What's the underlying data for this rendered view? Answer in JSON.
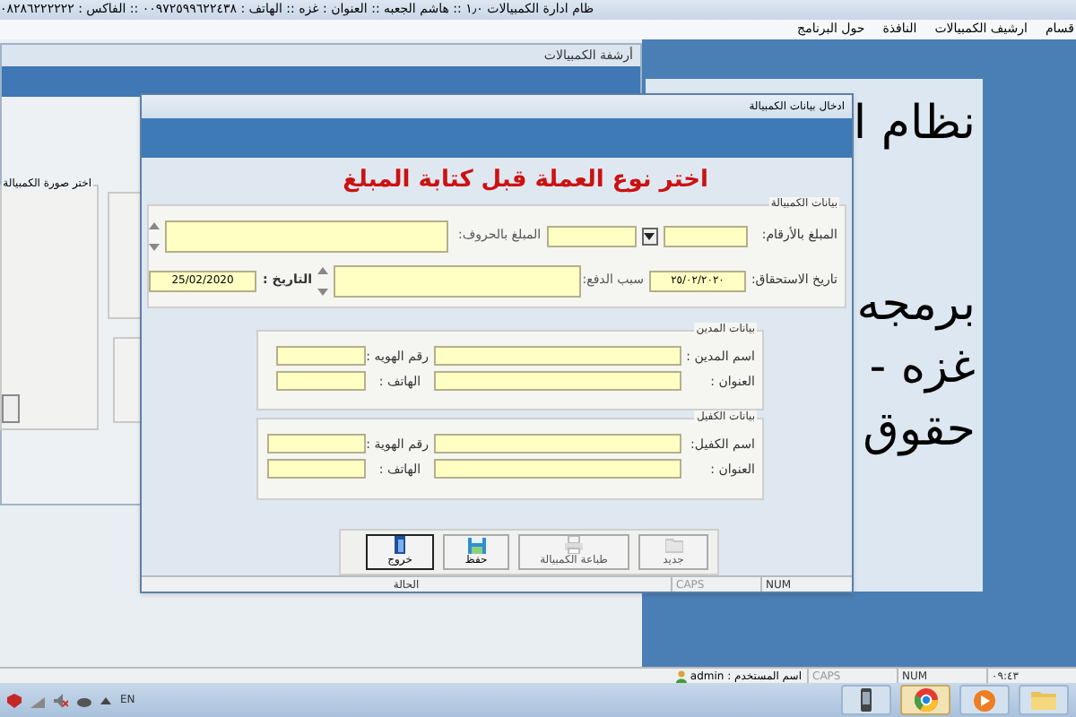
{
  "window": {
    "title": "ظام ادارة الكمبيالات ١٫٠ :: هاشم الجعبه :: العنوان : غزه :: الهاتف : ٠٠٩٧٢٥٩٩٦٢٢٤٣٨ :: الفاكس : ٠٨٢٨٦٢٢٢٢٢٢"
  },
  "menu": [
    {
      "label": "قسام"
    },
    {
      "label": "ارشيف الكمبيالات"
    },
    {
      "label": "النافذة"
    },
    {
      "label": "حول البرنامج"
    }
  ],
  "archive_window": {
    "title": "أرشفة الكمبيالات",
    "image_group": {
      "title": "اختر صورة الكمبيالة"
    }
  },
  "splash": {
    "lines": [
      "نظام ا",
      "برمجه",
      "غزه -",
      "حقوق"
    ]
  },
  "dialog": {
    "title": "ادخال بيانات الكمبيالة",
    "notice": "اختر نوع العملة قبل كتابة المبلغ",
    "bill_group": {
      "title": "بيانات الكمبيالة",
      "amount_digits": "المبلغ بالأرقام:",
      "amount_words": "المبلغ بالحروف:",
      "due_date": {
        "label": "تاريخ الاستحقاق:",
        "value": "٢٥/٠٢/٢٠٢٠"
      },
      "reason": "سبب الدفع:",
      "date": {
        "label": "التاريخ :",
        "value": "25/02/2020"
      }
    },
    "debtor_group": {
      "title": "بيانات المدين",
      "name": "اسم المدين :",
      "id": "رقم الهويه :",
      "address": "العنوان :",
      "phone": "الهاتف :"
    },
    "guarantor_group": {
      "title": "بيانات الكفيل",
      "name": "اسم الكفيل:",
      "id": "رقم الهوية :",
      "address": "العنوان :",
      "phone": "الهاتف :"
    },
    "buttons": [
      {
        "kind": "new",
        "label": "جديد",
        "disabled": true
      },
      {
        "kind": "print",
        "label": "طباعة الكمبيالة",
        "disabled": true
      },
      {
        "kind": "save",
        "label": "حفظ",
        "disabled": false
      },
      {
        "kind": "exit",
        "label": "خروج",
        "disabled": false
      }
    ],
    "status": {
      "state": "الحالة",
      "caps": "CAPS",
      "num": "NUM"
    }
  },
  "status_bar": {
    "user": "اسم المستخدم : admin",
    "caps": "CAPS",
    "num": "NUM",
    "time": "٠٩:٤٣"
  },
  "taskbar": {
    "language": "EN"
  }
}
